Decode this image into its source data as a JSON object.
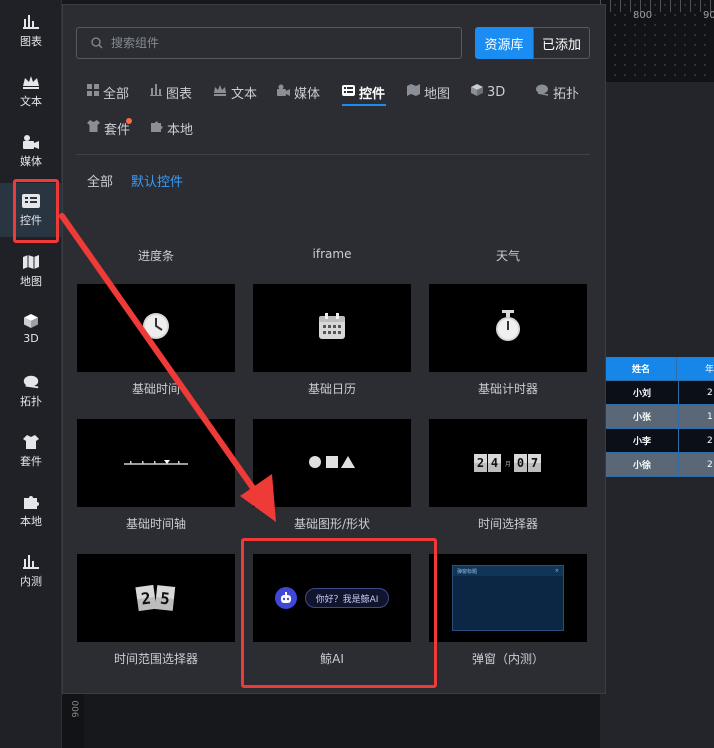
{
  "sidebar": {
    "items": [
      {
        "label": "图表",
        "icon": "bar-chart-icon"
      },
      {
        "label": "文本",
        "icon": "text-crown-icon"
      },
      {
        "label": "媒体",
        "icon": "media-camera-icon"
      },
      {
        "label": "控件",
        "icon": "widget-icon"
      },
      {
        "label": "地图",
        "icon": "map-icon"
      },
      {
        "label": "3D",
        "icon": "cube-icon"
      },
      {
        "label": "拓扑",
        "icon": "topology-icon"
      },
      {
        "label": "套件",
        "icon": "shirt-kit-icon"
      },
      {
        "label": "本地",
        "icon": "puzzle-icon"
      },
      {
        "label": "内测",
        "icon": "beta-chart-icon"
      }
    ],
    "active": "控件"
  },
  "search": {
    "placeholder": "搜索组件"
  },
  "source_toggle": {
    "library": "资源库",
    "added": "已添加",
    "selected": "资源库"
  },
  "categories": {
    "all": "全部",
    "chart": "图表",
    "text": "文本",
    "media": "媒体",
    "widget": "控件",
    "map": "地图",
    "three_d": "3D",
    "topology": "拓扑",
    "kit": "套件",
    "local": "本地",
    "active": "控件"
  },
  "subfilter": {
    "all": "全部",
    "default": "默认控件",
    "active": "默认控件"
  },
  "top_labels": [
    "进度条",
    "iframe",
    "天气"
  ],
  "cards": [
    {
      "label": "基础时间"
    },
    {
      "label": "基础日历"
    },
    {
      "label": "基础计时器"
    },
    {
      "label": "基础时间轴"
    },
    {
      "label": "基础图形/形状"
    },
    {
      "label": "时间选择器",
      "digits": [
        "2",
        "4",
        "0",
        "7"
      ],
      "sep": "月"
    },
    {
      "label": "时间范围选择器",
      "digits": [
        "2",
        "5"
      ]
    },
    {
      "label": "鲸AI",
      "bubble": "你好？我是鲸AI"
    },
    {
      "label": "弹窗（内测）",
      "dialog_title": "弹窗标题",
      "dialog_close": "×"
    }
  ],
  "canvas": {
    "ruler_labels": [
      "800",
      "90"
    ],
    "vertical_ruler_label": "900",
    "table": {
      "header": [
        "姓名",
        "年"
      ],
      "rows": [
        [
          "小刘",
          "2"
        ],
        [
          "小张",
          "1"
        ],
        [
          "小李",
          "2"
        ],
        [
          "小徐",
          "2"
        ]
      ]
    }
  },
  "colors": {
    "accent": "#1b8cf2",
    "highlight": "#ef3b37",
    "panel": "#2b2d33"
  }
}
